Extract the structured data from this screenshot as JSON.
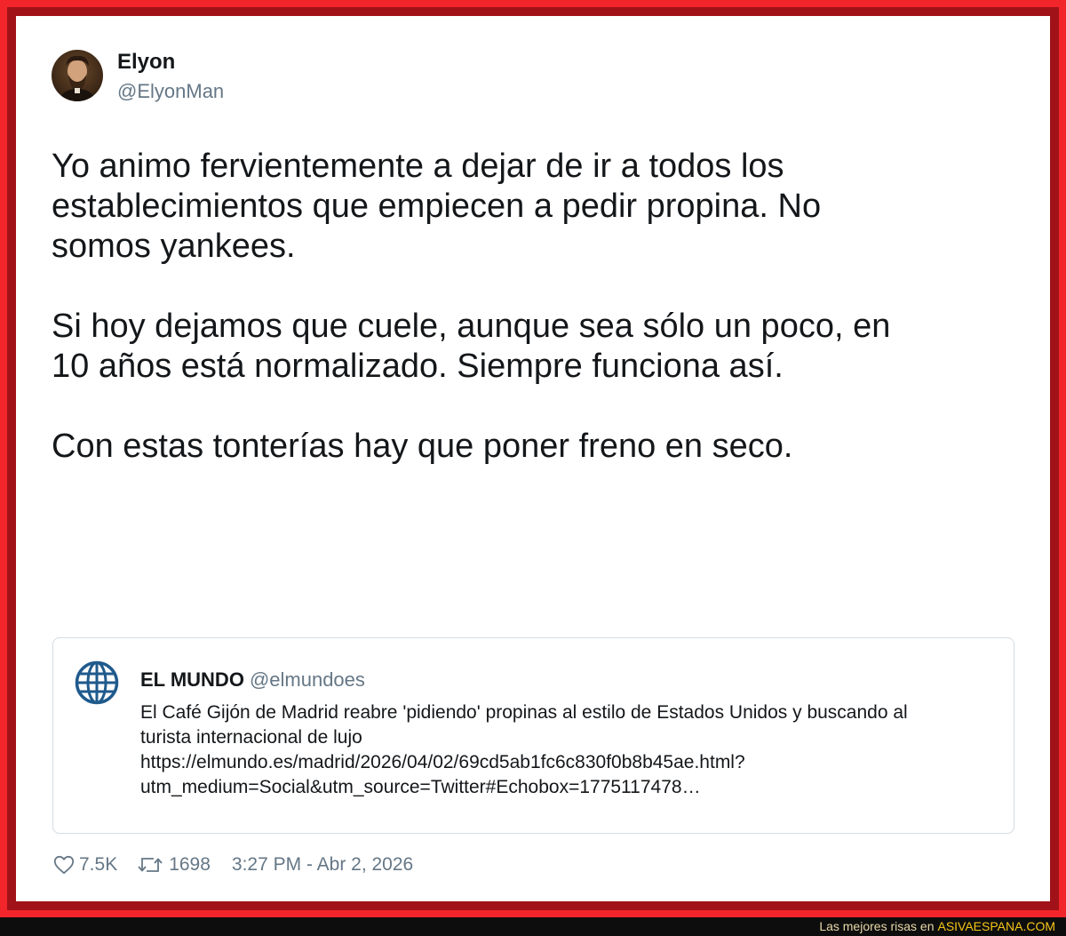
{
  "tweet": {
    "author": {
      "name": "Elyon",
      "handle": "@ElyonMan"
    },
    "paragraphs": [
      "Yo animo fervientemente a dejar de ir a todos los\nestablecimientos que empiecen a pedir propina. No\nsomos yankees.",
      "Si hoy dejamos que cuele, aunque sea sólo un poco, en\n10 años está normalizado. Siempre funciona así.",
      "Con estas tonterías hay que poner freno en seco."
    ],
    "quote": {
      "name": "EL MUNDO",
      "handle": "@elmundoes",
      "lines": [
        "El Café Gijón de Madrid reabre 'pidiendo' propinas al estilo de Estados Unidos y buscando al",
        "turista internacional de lujo",
        "https://elmundo.es/madrid/2026/04/02/69cd5ab1fc6c830f0b8b45ae.html?",
        "utm_medium=Social&utm_source=Twitter#Echobox=1775117478…"
      ]
    },
    "stats": {
      "likes": "7.5K",
      "retweets": "1698",
      "timestamp": "3:27 PM - Abr 2, 2026"
    }
  },
  "footer": {
    "prefix": "Las mejores risas en",
    "brand": "ASIVAESPANA.COM"
  },
  "colors": {
    "frame": "#f2252b",
    "frame_inner": "#a01217",
    "secondary_text": "#657786",
    "brand_yellow": "#f5c518",
    "logo_blue": "#1f5a8c"
  },
  "icons": {
    "like": "heart-icon",
    "retweet": "retweet-icon",
    "quote_logo": "globe-icon"
  }
}
